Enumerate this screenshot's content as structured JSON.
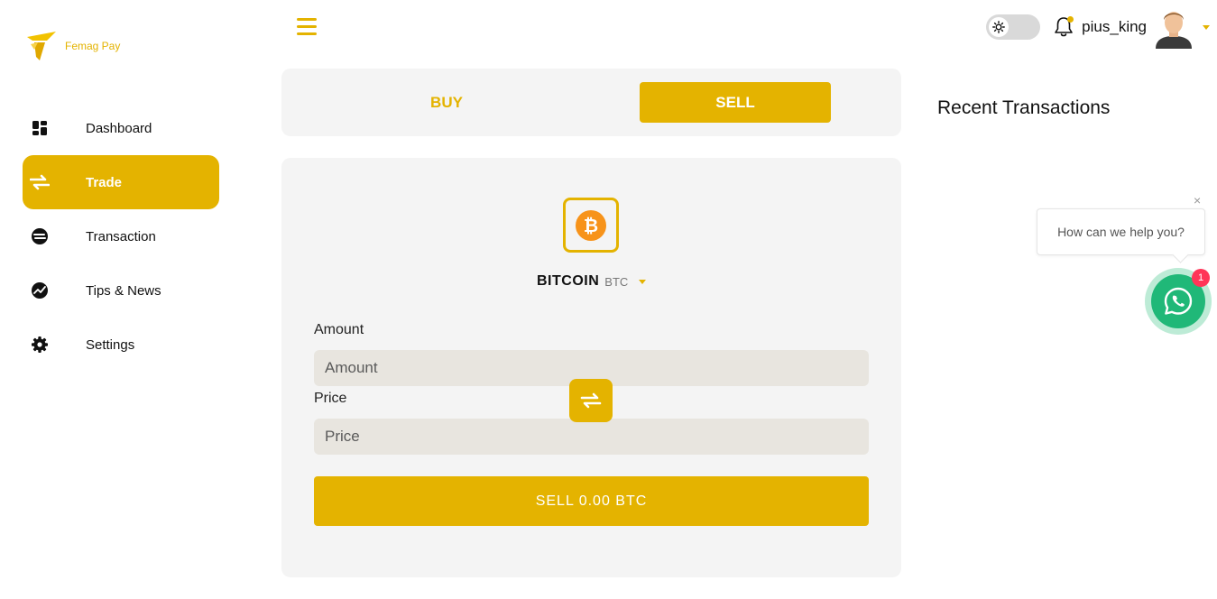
{
  "brand": {
    "name": "Femag Pay",
    "accent": "#e4b300"
  },
  "sidebar": {
    "items": [
      {
        "label": "Dashboard",
        "icon": "dashboard-icon"
      },
      {
        "label": "Trade",
        "icon": "swap-icon",
        "active": true
      },
      {
        "label": "Transaction",
        "icon": "transaction-icon"
      },
      {
        "label": "Tips & News",
        "icon": "news-icon"
      },
      {
        "label": "Settings",
        "icon": "gear-icon"
      }
    ]
  },
  "header": {
    "username": "pius_king",
    "theme": "light"
  },
  "tabs": {
    "buy": "BUY",
    "sell": "SELL",
    "selected": "SELL"
  },
  "trade": {
    "coin_name": "BITCOIN",
    "coin_symbol": "BTC",
    "amount_label": "Amount",
    "amount_placeholder": "Amount",
    "price_label": "Price",
    "price_placeholder": "Price",
    "submit_label": "SELL 0.00 BTC"
  },
  "recent": {
    "title": "Recent Transactions"
  },
  "chat": {
    "prompt": "How can we help you?",
    "badge": "1",
    "close": "×"
  }
}
